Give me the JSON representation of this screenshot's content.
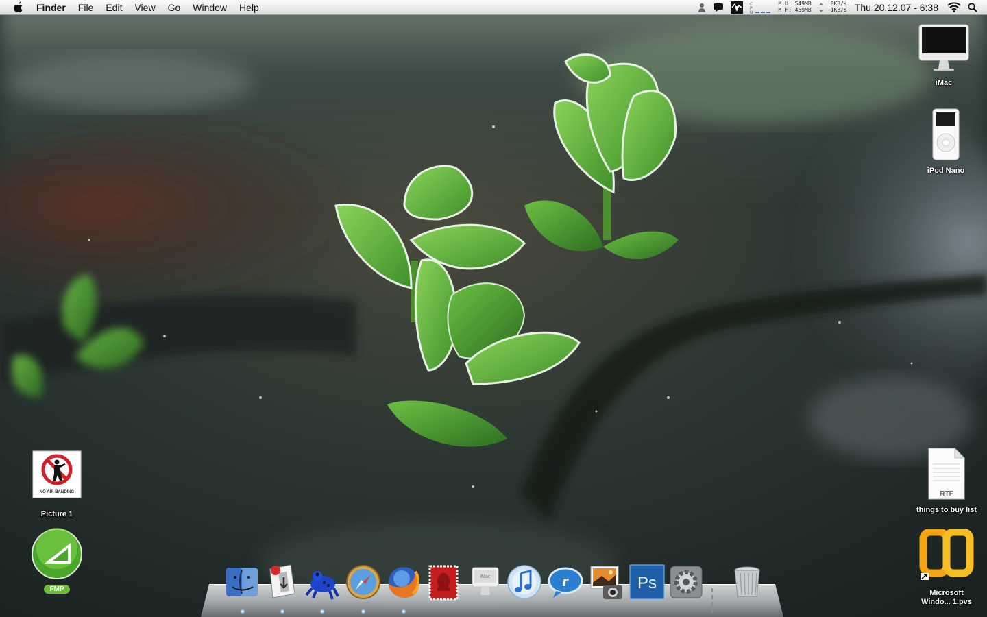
{
  "menubar": {
    "apple_icon": "apple-logo-icon",
    "app_name": "Finder",
    "menus": [
      "File",
      "Edit",
      "View",
      "Go",
      "Window",
      "Help"
    ],
    "status": {
      "mem_u": "549MB",
      "mem_f": "469MB",
      "net_in": "0KB/s",
      "net_out": "1KB/s",
      "clock": "Thu 20.12.07 - 6:38"
    }
  },
  "desktop": {
    "icons": [
      {
        "label": "iMac",
        "icon": "imac-icon"
      },
      {
        "label": "iPod Nano",
        "icon": "ipod-icon"
      },
      {
        "label": "things to buy list",
        "icon": "rtf-document-icon",
        "badge": "RTF"
      },
      {
        "label": "Picture 1",
        "icon": "image-file-icon",
        "caption": "NO AIR BANDING"
      },
      {
        "label": "FMP",
        "icon": "fmp-app-icon"
      },
      {
        "label": "Microsoft Windo... 1.pvs",
        "icon": "parallels-vm-icon"
      }
    ]
  },
  "dock": {
    "items": [
      {
        "name": "Finder",
        "icon": "finder-icon",
        "running": true
      },
      {
        "name": "Transmit",
        "icon": "transmit-icon",
        "running": true
      },
      {
        "name": "Frog",
        "icon": "frog-icon",
        "running": true
      },
      {
        "name": "Safari",
        "icon": "safari-icon",
        "running": true
      },
      {
        "name": "Firefox",
        "icon": "firefox-icon",
        "running": true
      },
      {
        "name": "Mail Stamp",
        "icon": "stamp-icon",
        "running": false
      },
      {
        "name": "iMac",
        "icon": "imac-dock-icon",
        "running": false
      },
      {
        "name": "iTunes",
        "icon": "itunes-icon",
        "running": false
      },
      {
        "name": "RealPlayer",
        "icon": "realplayer-icon",
        "running": false
      },
      {
        "name": "iPhoto",
        "icon": "iphoto-icon",
        "running": false
      },
      {
        "name": "Photoshop",
        "icon": "photoshop-icon",
        "running": false
      },
      {
        "name": "System Preferences",
        "icon": "system-preferences-icon",
        "running": false
      },
      {
        "name": "Trash",
        "icon": "trash-icon",
        "running": false
      }
    ],
    "imac_label": "iMac",
    "ps_label": "Ps"
  },
  "colors": {
    "menubar_bg": "#e9e9e9",
    "wallpaper_dark": "#1c2623",
    "leaf_green": "#5fae3a"
  }
}
